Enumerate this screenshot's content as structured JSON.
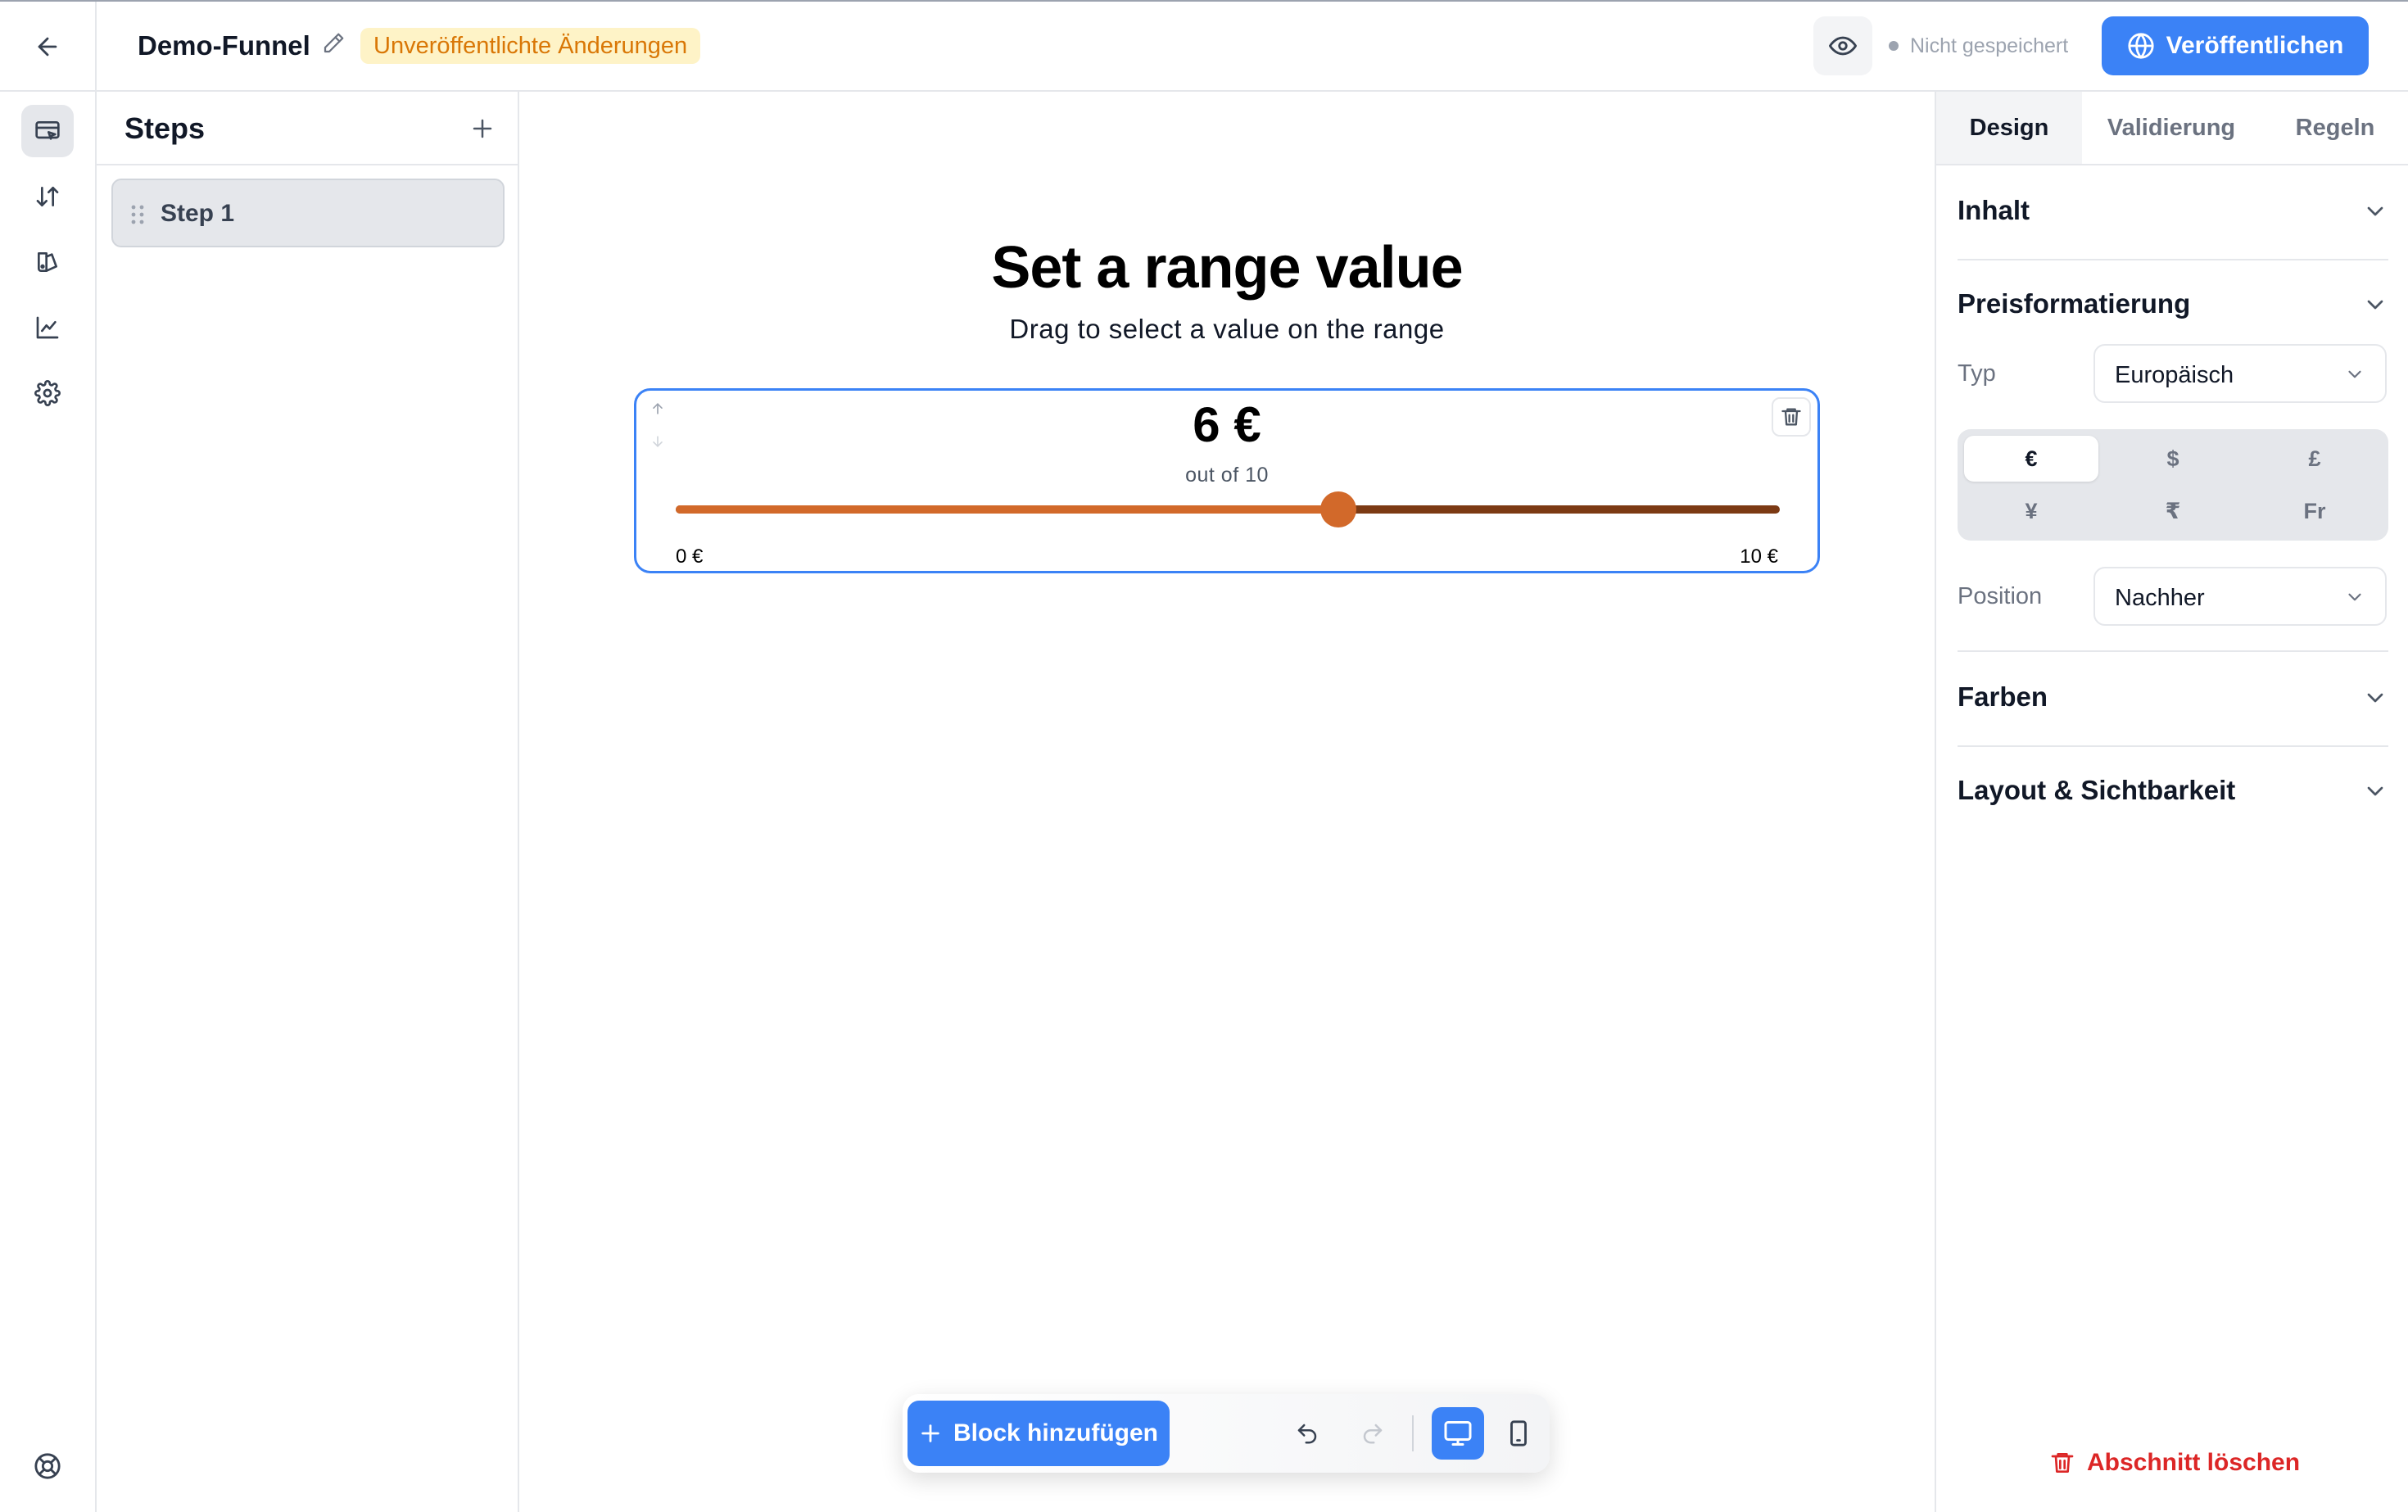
{
  "header": {
    "funnel_name": "Demo-Funnel",
    "unsaved_badge": "Unveröffentlichte Änderungen",
    "save_status": "Nicht gespeichert",
    "publish_label": "Veröffentlichen"
  },
  "rail": {
    "items": [
      {
        "icon": "editor-icon",
        "active": true
      },
      {
        "icon": "sort-arrows-icon",
        "active": false
      },
      {
        "icon": "theme-icon",
        "active": false
      },
      {
        "icon": "analytics-chart-icon",
        "active": false
      },
      {
        "icon": "settings-gear-icon",
        "active": false
      }
    ],
    "bottom_icon": "help-lifebuoy-icon"
  },
  "steps": {
    "title": "Steps",
    "items": [
      {
        "label": "Step 1"
      }
    ]
  },
  "canvas": {
    "title": "Set a range value",
    "subtitle": "Drag to select a value on the range",
    "range": {
      "value_display": "6 €",
      "out_of": "out of 10",
      "min_label": "0 €",
      "max_label": "10 €",
      "value": 6,
      "min": 0,
      "max": 10
    }
  },
  "toolbar": {
    "add_block_label": "Block hinzufügen"
  },
  "properties": {
    "tabs": [
      {
        "label": "Design",
        "active": true
      },
      {
        "label": "Validierung",
        "active": false
      },
      {
        "label": "Regeln",
        "active": false
      }
    ],
    "sections": {
      "inhalt": "Inhalt",
      "preisformatierung": "Preisformatierung",
      "farben": "Farben",
      "layout": "Layout & Sichtbarkeit"
    },
    "typ_label": "Typ",
    "typ_value": "Europäisch",
    "position_label": "Position",
    "position_value": "Nachher",
    "currencies": [
      "€",
      "$",
      "£",
      "¥",
      "₹",
      "Fr"
    ],
    "selected_currency": "€",
    "delete_section_label": "Abschnitt löschen"
  },
  "colors": {
    "accent": "#3b82f6",
    "slider_fill": "#d2692a",
    "slider_track": "#7c3a14",
    "warning_bg": "#fef3c7",
    "warning_text": "#d97706",
    "danger": "#dc2626"
  }
}
